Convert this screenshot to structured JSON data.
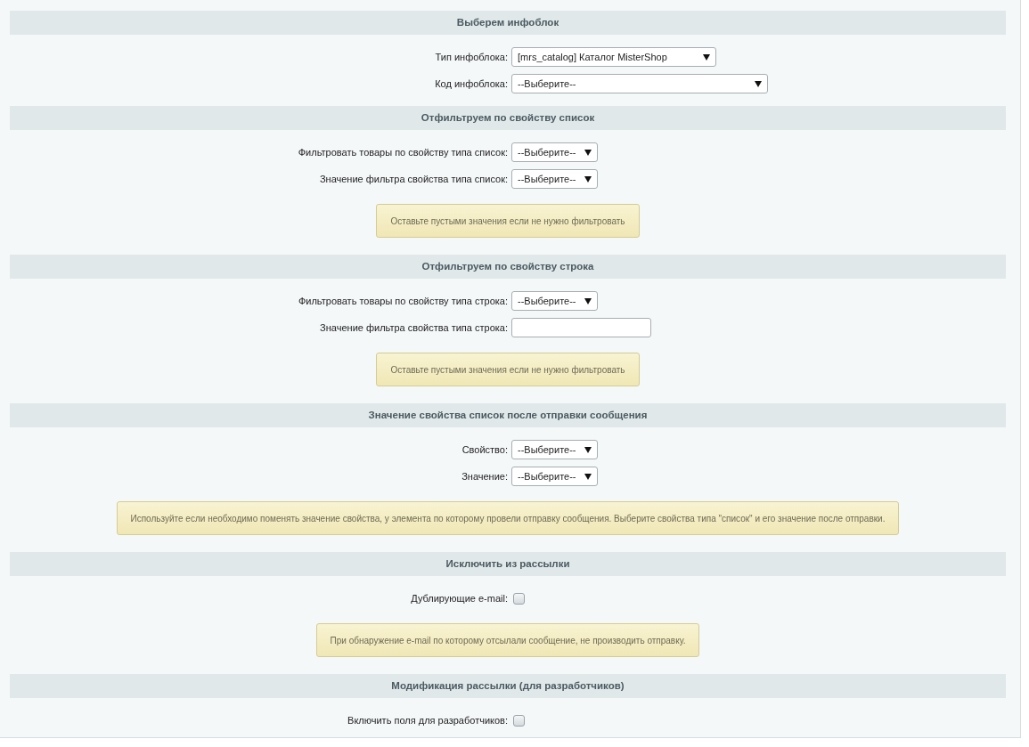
{
  "sections": [
    {
      "title": "Выберем инфоблок",
      "rows": [
        {
          "kind": "select",
          "label": "Тип инфоблока:",
          "value": "[mrs_catalog] Каталог MisterShop"
        },
        {
          "kind": "select",
          "label": "Код инфоблока:",
          "value": "--Выберите--"
        }
      ]
    },
    {
      "title": "Отфильтруем по свойству список",
      "rows": [
        {
          "kind": "select",
          "label": "Фильтровать товары по свойству типа список:",
          "value": "--Выберите--"
        },
        {
          "kind": "select",
          "label": "Значение фильтра свойства типа список:",
          "value": "--Выберите--"
        }
      ],
      "note": "Оставьте пустыми значения если не нужно фильтровать"
    },
    {
      "title": "Отфильтруем по свойству строка",
      "rows": [
        {
          "kind": "select",
          "label": "Фильтровать товары по свойству типа строка:",
          "value": "--Выберите--"
        },
        {
          "kind": "text",
          "label": "Значение фильтра свойства типа строка:"
        }
      ],
      "note": "Оставьте пустыми значения если не нужно фильтровать"
    },
    {
      "title": "Значение свойства список после отправки сообщения",
      "rows": [
        {
          "kind": "select",
          "label": "Свойство:",
          "value": "--Выберите--"
        },
        {
          "kind": "select",
          "label": "Значение:",
          "value": "--Выберите--"
        }
      ],
      "note": "Используйте если необходимо поменять значение свойства, у элемента по которому провели отправку сообщения. Выберите свойства типа \"список\" и его значение после отправки."
    },
    {
      "title": "Исключить из рассылки",
      "rows": [
        {
          "kind": "checkbox",
          "label": "Дублирующие e-mail:",
          "checked": false
        }
      ],
      "note": "При обнаружение e-mail по которому отсылали сообщение, не производить отправку."
    },
    {
      "title": "Модификация рассылки (для разработчиков)",
      "rows": [
        {
          "kind": "checkbox",
          "label": "Включить поля для разработчиков:",
          "checked": false
        }
      ]
    }
  ]
}
